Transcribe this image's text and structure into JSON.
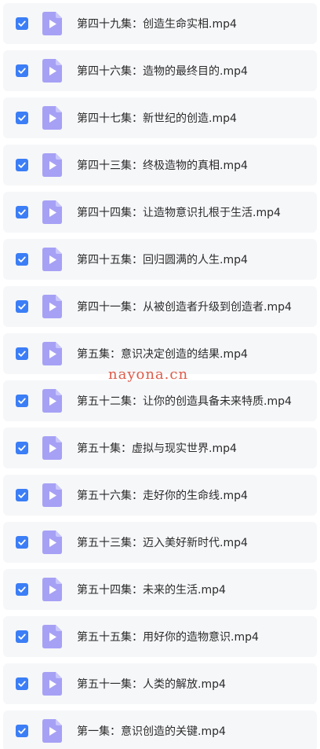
{
  "files": [
    {
      "name": "第四十九集：创造生命实相.mp4",
      "checked": true,
      "icon": "video-file-icon"
    },
    {
      "name": "第四十六集：造物的最终目的.mp4",
      "checked": true,
      "icon": "video-file-icon"
    },
    {
      "name": "第四十七集：新世纪的创造.mp4",
      "checked": true,
      "icon": "video-file-icon"
    },
    {
      "name": "第四十三集：终极造物的真相.mp4",
      "checked": true,
      "icon": "video-file-icon"
    },
    {
      "name": "第四十四集：让造物意识扎根于生活.mp4",
      "checked": true,
      "icon": "video-file-icon"
    },
    {
      "name": "第四十五集：回归圆满的人生.mp4",
      "checked": true,
      "icon": "video-file-icon"
    },
    {
      "name": "第四十一集：从被创造者升级到创造者.mp4",
      "checked": true,
      "icon": "video-file-icon"
    },
    {
      "name": "第五集：意识决定创造的结果.mp4",
      "checked": true,
      "icon": "video-file-icon"
    },
    {
      "name": "第五十二集：让你的创造具备未来特质.mp4",
      "checked": true,
      "icon": "video-file-icon"
    },
    {
      "name": "第五十集：虚拟与现实世界.mp4",
      "checked": true,
      "icon": "video-file-icon"
    },
    {
      "name": "第五十六集：走好你的生命线.mp4",
      "checked": true,
      "icon": "video-file-icon"
    },
    {
      "name": "第五十三集：迈入美好新时代.mp4",
      "checked": true,
      "icon": "video-file-icon"
    },
    {
      "name": "第五十四集：未来的生活.mp4",
      "checked": true,
      "icon": "video-file-icon"
    },
    {
      "name": "第五十五集：用好你的造物意识.mp4",
      "checked": true,
      "icon": "video-file-icon"
    },
    {
      "name": "第五十一集：人类的解放.mp4",
      "checked": true,
      "icon": "video-file-icon"
    },
    {
      "name": "第一集：意识创造的关键.mp4",
      "checked": true,
      "icon": "video-file-icon"
    }
  ],
  "watermark": "nayona.cn",
  "colors": {
    "checkbox": "#3b7ef6",
    "file_icon": "#a6a1f5",
    "row_background": "#f6f7f9",
    "watermark": "#d9402b"
  }
}
